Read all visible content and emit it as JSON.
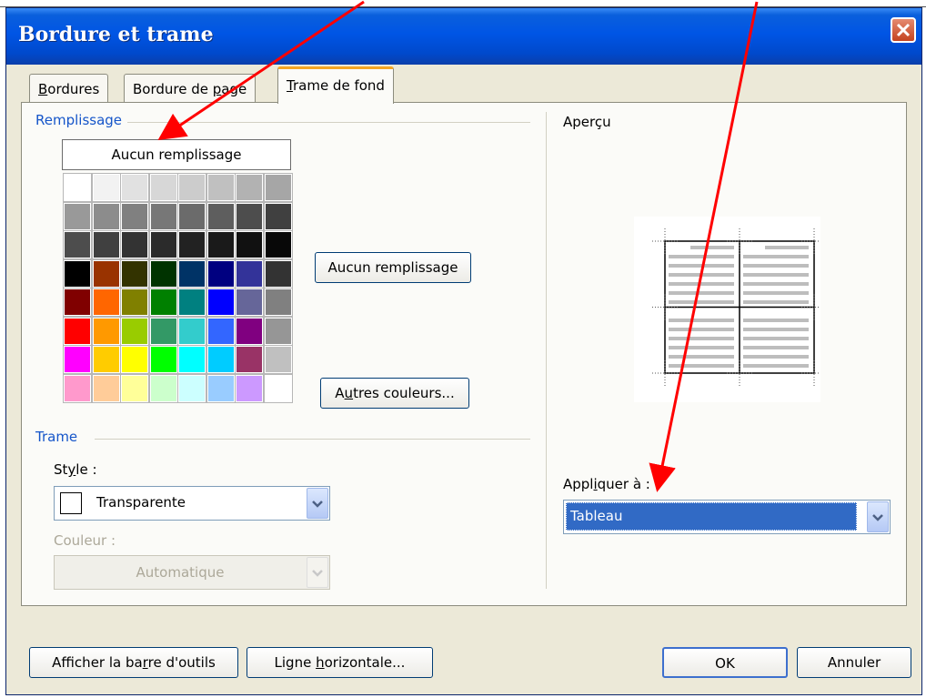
{
  "dialog": {
    "title": "Bordure et trame",
    "tabs": [
      {
        "label_pre": "",
        "label_u": "B",
        "label_post": "ordures"
      },
      {
        "label_pre": "Bordure de ",
        "label_u": "p",
        "label_post": "age"
      },
      {
        "label_pre": "",
        "label_u": "T",
        "label_post": "rame de fond"
      }
    ],
    "active_tab": 2
  },
  "fill": {
    "section_label": "Remplissage",
    "no_fill_cell": "Aucun remplissage",
    "no_fill_button": "Aucun remplissage",
    "more_colors_pre": "A",
    "more_colors_u": "u",
    "more_colors_post": "tres couleurs...",
    "colors": [
      [
        "#ffffff",
        "#f2f2f2",
        "#e1e1e1",
        "#d7d7d7",
        "#cccccc",
        "#c0c0c0",
        "#b2b2b2",
        "#a6a6a6"
      ],
      [
        "#999999",
        "#8c8c8c",
        "#808080",
        "#777777",
        "#6b6b6b",
        "#5e5e5e",
        "#4d4d4d",
        "#404040"
      ],
      [
        "#4d4d4d",
        "#404040",
        "#333333",
        "#2b2b2b",
        "#222222",
        "#1a1a1a",
        "#111111",
        "#080808"
      ],
      [
        "#000000",
        "#993300",
        "#333300",
        "#003300",
        "#003366",
        "#000080",
        "#333399",
        "#333333"
      ],
      [
        "#800000",
        "#ff6600",
        "#808000",
        "#008000",
        "#008080",
        "#0000ff",
        "#666699",
        "#808080"
      ],
      [
        "#ff0000",
        "#ff9900",
        "#99cc00",
        "#339966",
        "#33cccc",
        "#3366ff",
        "#800080",
        "#969696"
      ],
      [
        "#ff00ff",
        "#ffcc00",
        "#ffff00",
        "#00ff00",
        "#00ffff",
        "#00ccff",
        "#993366",
        "#c0c0c0"
      ],
      [
        "#ff99cc",
        "#ffcc99",
        "#ffff99",
        "#ccffcc",
        "#ccffff",
        "#99ccff",
        "#cc99ff",
        "#ffffff"
      ]
    ]
  },
  "pattern": {
    "section_label": "Trame",
    "style_label_pre": "St",
    "style_label_u": "y",
    "style_label_post": "le :",
    "style_value": "Transparente",
    "color_label": "Couleur :",
    "color_value": "Automatique"
  },
  "preview": {
    "label": "Aperçu",
    "apply_label_pre": "Appl",
    "apply_label_u": "i",
    "apply_label_post": "quer à :",
    "apply_value": "Tableau"
  },
  "footer": {
    "toolbar_pre": "Afficher la ba",
    "toolbar_u": "r",
    "toolbar_post": "re d'outils",
    "hline_pre": "Ligne ",
    "hline_u": "h",
    "hline_post": "orizontale...",
    "ok": "OK",
    "cancel": "Annuler"
  },
  "colors": {
    "title_bar": "#0055e5",
    "accent_label": "#1555c9",
    "selected": "#316ac5",
    "annotation_arrow": "#ff0000"
  }
}
